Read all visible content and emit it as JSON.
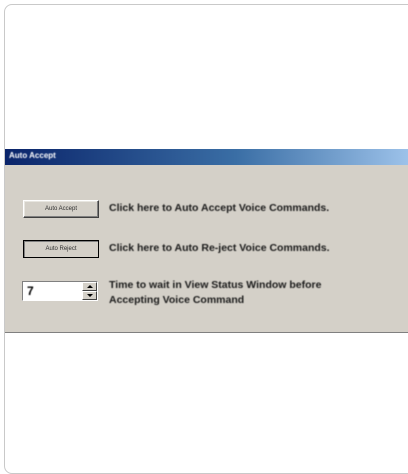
{
  "dialog": {
    "title": "Auto Accept",
    "accept_button_label": "Auto Accept",
    "accept_description": "Click here to Auto Accept Voice Commands.",
    "reject_button_label": "Auto Reject",
    "reject_description": "Click here to Auto Re-ject Voice Commands.",
    "wait_value": "7",
    "wait_description_line1": "Time to wait in View Status Window before",
    "wait_description_line2": "Accepting Voice Command"
  },
  "icons": {
    "spin_up": "arrow-up-icon",
    "spin_down": "arrow-down-icon"
  },
  "colors": {
    "dialog_face": "#d4d0c8",
    "titlebar_start": "#0a246a",
    "titlebar_end": "#a6caf0"
  }
}
